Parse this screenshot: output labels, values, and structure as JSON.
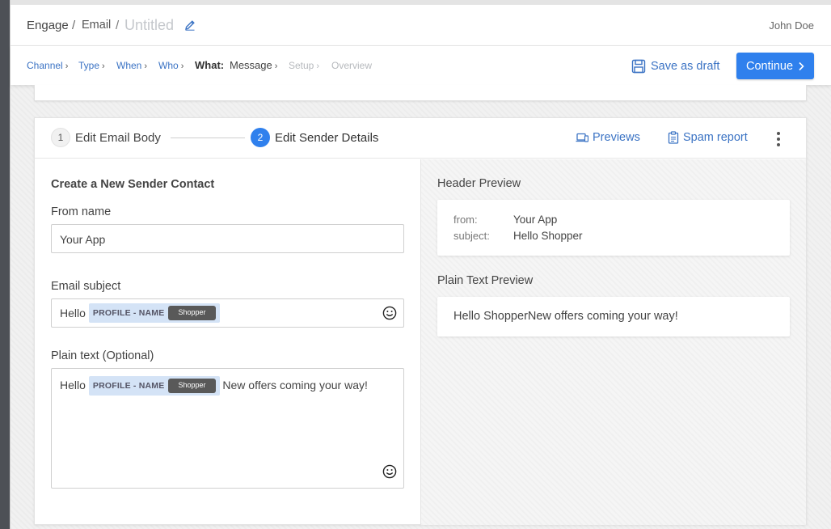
{
  "header": {
    "breadcrumb": [
      "Engage",
      "Email",
      "Untitled"
    ],
    "separator": "/",
    "user_name": "John Doe"
  },
  "steps": {
    "items": [
      {
        "label": "Channel",
        "state": "done"
      },
      {
        "label": "Type",
        "state": "done"
      },
      {
        "label": "When",
        "state": "done"
      },
      {
        "label": "Who",
        "state": "done"
      }
    ],
    "what_label": "What:",
    "current": "Message",
    "upcoming": [
      "Setup",
      "Overview"
    ],
    "chevron": "›"
  },
  "actions": {
    "save_draft": "Save as draft",
    "continue": "Continue"
  },
  "editor": {
    "tab1_num": "1",
    "tab1_label": "Edit Email Body",
    "tab2_num": "2",
    "tab2_label": "Edit Sender Details",
    "previews_label": "Previews",
    "spam_label": "Spam report"
  },
  "form": {
    "section_title": "Create a New Sender Contact",
    "from_name_label": "From name",
    "from_name_value": "Your App",
    "subject_label": "Email subject",
    "subject_prefix": "Hello",
    "token_attr": "PROFILE - NAME",
    "token_value": "Shopper",
    "plain_label": "Plain text (Optional)",
    "plain_prefix": "Hello",
    "plain_suffix": "New offers coming your way!"
  },
  "preview": {
    "header_title": "Header Preview",
    "from_key": "from:",
    "from_value": "Your App",
    "subject_key": "subject:",
    "subject_value": "Hello Shopper",
    "plain_title": "Plain Text Preview",
    "plain_text": "Hello ShopperNew offers coming your way!"
  },
  "colors": {
    "accent": "#2f80ed",
    "link": "#3b73c4",
    "token_bg": "#d4e3f6",
    "token_value_bg": "#595959"
  }
}
